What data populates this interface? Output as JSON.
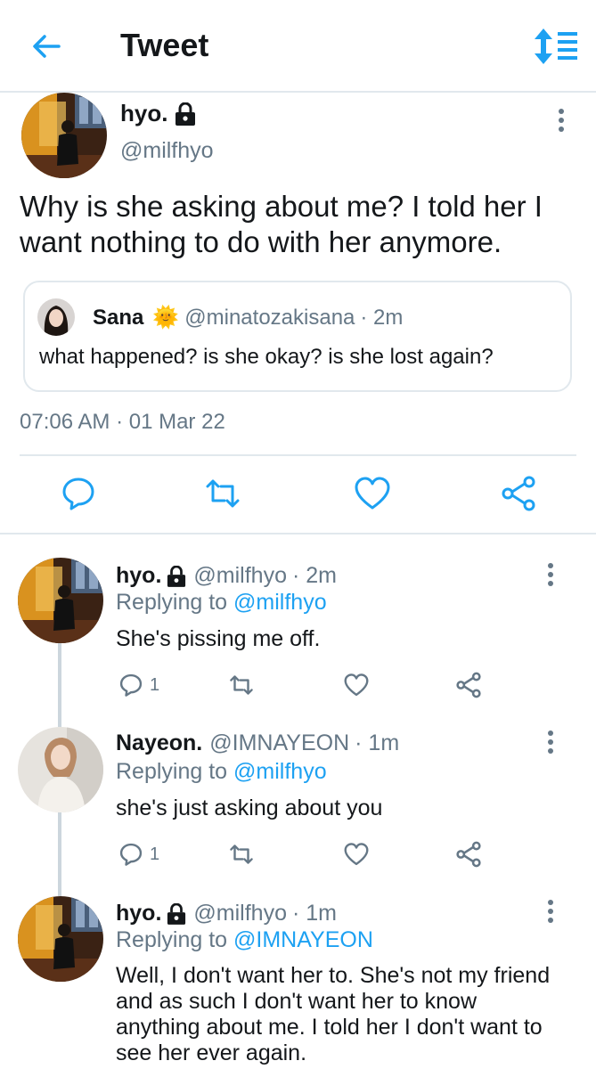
{
  "header": {
    "title": "Tweet",
    "accent_color": "#1da1f2"
  },
  "main_tweet": {
    "name": "hyo.",
    "handle": "@milfhyo",
    "text": "Why is she asking about me? I told her I want nothing to do with her anymore.",
    "quote": {
      "name": "Sana",
      "emoji": "🌞",
      "handle": "@minatozakisana",
      "time": "· 2m",
      "text": "what happened? is she okay? is she lost again?"
    },
    "timestamp": "07:06 AM · 01 Mar 22"
  },
  "replies": [
    {
      "name": "hyo.",
      "handle": "@milfhyo",
      "time": "· 2m",
      "replying_prefix": "Replying to",
      "replying_to": "@milfhyo",
      "text": "She's pissing me off.",
      "reply_count": "1"
    },
    {
      "name": "Nayeon.",
      "handle": "@IMNAYEON",
      "time": "· 1m",
      "replying_prefix": "Replying to",
      "replying_to": "@milfhyo",
      "text": "she's just asking about you",
      "reply_count": "1"
    },
    {
      "name": "hyo.",
      "handle": "@milfhyo",
      "time": "· 1m",
      "replying_prefix": "Replying to",
      "replying_to": "@IMNAYEON",
      "text": "Well, I don't want her to. She's not my friend and as such I don't want her to know anything about me. I told her I don't want to see her ever again."
    }
  ]
}
